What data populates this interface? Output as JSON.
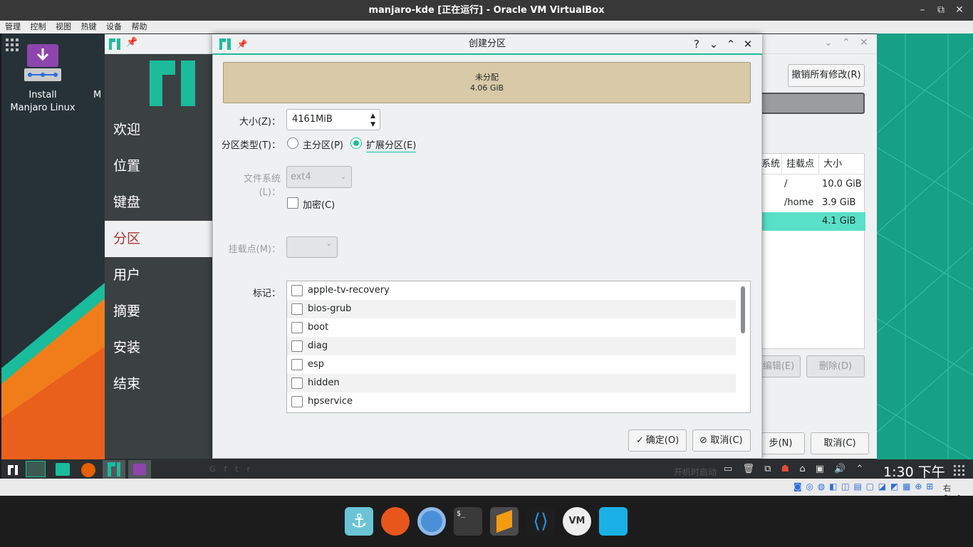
{
  "window": {
    "title": "manjaro-kde [正在运行] - Oracle VM VirtualBox"
  },
  "menubar": [
    "管理",
    "控制",
    "视图",
    "热键",
    "设备",
    "帮助"
  ],
  "desktop": {
    "install_icon_label_1": "Install",
    "install_icon_label_2": "Manjaro Linux",
    "partial_label": "M"
  },
  "installer": {
    "sidebar": [
      "欢迎",
      "位置",
      "键盘",
      "分区",
      "用户",
      "摘要",
      "安装",
      "结束"
    ],
    "revert_button": "撤销所有修改(R)",
    "table_headers": [
      "系统",
      "挂载点",
      "大小"
    ],
    "table_rows": [
      {
        "mount": "/",
        "size": "10.0 GiB"
      },
      {
        "mount": "/home",
        "size": "3.9 GiB"
      },
      {
        "mount": "",
        "size": "4.1 GiB"
      }
    ],
    "edit_button": "编辑(E)",
    "delete_button": "删除(D)",
    "next_button": "步(N)",
    "cancel_button": "取消(C)"
  },
  "dialog": {
    "title": "创建分区",
    "unallocated_label": "未分配",
    "unallocated_size": "4.06 GiB",
    "size_label": "大小(Z)：",
    "size_value": "4161MiB",
    "type_label": "分区类型(T)：",
    "primary_label": "主分区(P)",
    "extended_label": "扩展分区(E)",
    "fs_label": "文件系统 (L)：",
    "fs_value": "ext4",
    "encrypt_label": "加密(C)",
    "mount_label": "挂载点(M)：",
    "flags_label": "标记：",
    "flags": [
      "apple-tv-recovery",
      "bios-grub",
      "boot",
      "diag",
      "esp",
      "hidden",
      "hpservice"
    ],
    "ok_button": "确定(O)",
    "cancel_button": "取消(C)"
  },
  "taskbar": {
    "clock": "1:30 下午",
    "autostart_text": "开机时启动"
  },
  "statusbar": {
    "host_key": "右 Ctrl"
  },
  "colors": {
    "accent": "#1abc9c",
    "sidebar": "#3b4043",
    "unallocated": "#d8c9a7",
    "selected_row": "#58e0c8"
  }
}
